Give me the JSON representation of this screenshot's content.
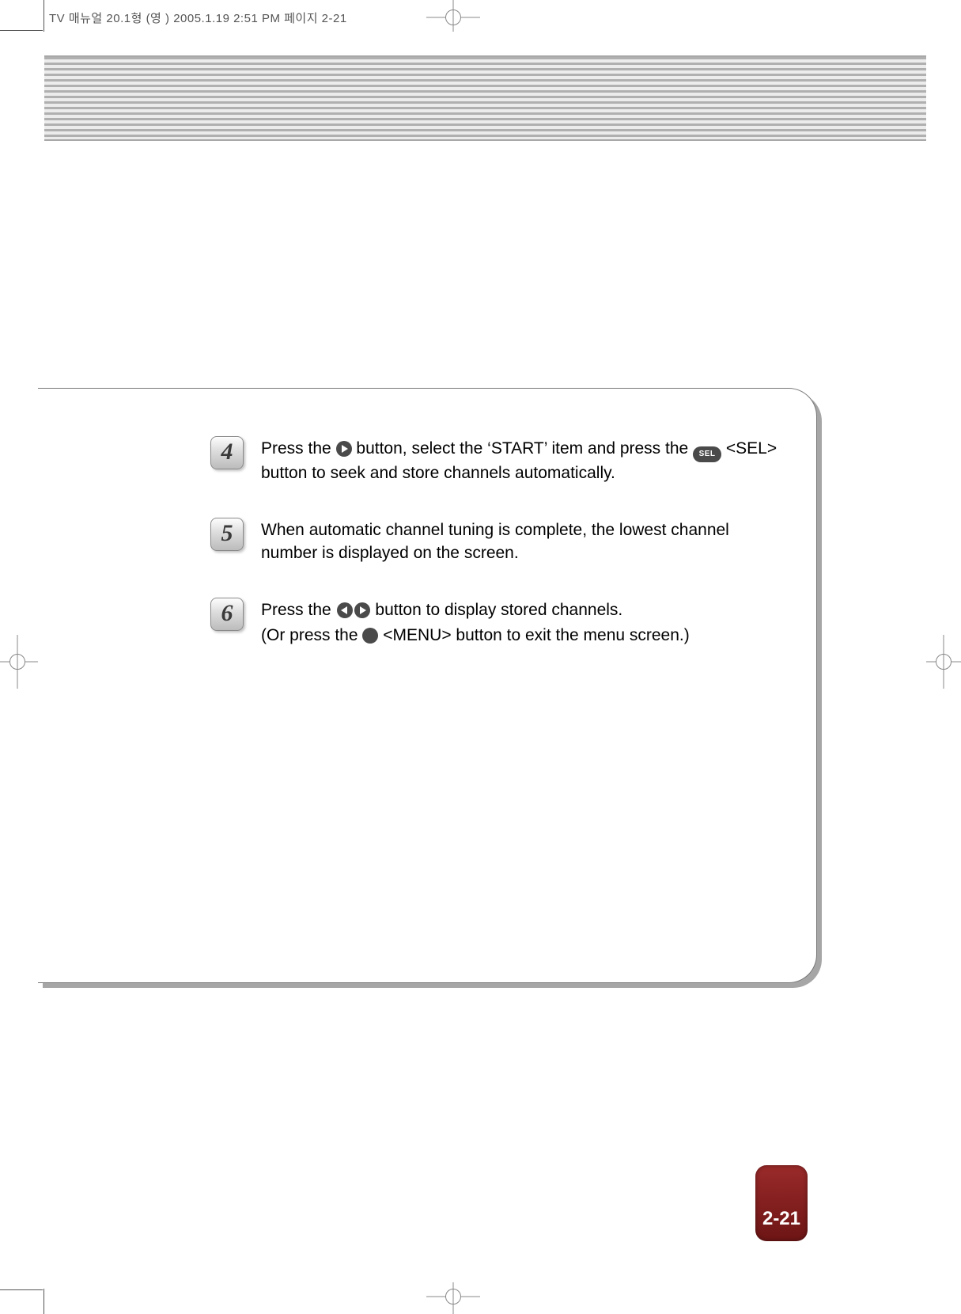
{
  "header": {
    "job_info": "TV 매뉴얼 20.1형 (영 )  2005.1.19 2:51 PM  페이지 2-21"
  },
  "steps": {
    "4": {
      "number": "4",
      "text_a": "Press the ",
      "text_b": " button, select the ‘START’ item and press the ",
      "sel_label": "SEL",
      "text_c": " <SEL> button to seek and store channels automatically."
    },
    "5": {
      "number": "5",
      "text": "When automatic channel tuning is complete, the lowest channel number is displayed on the screen."
    },
    "6": {
      "number": "6",
      "text_a": "Press the ",
      "text_b": " button to display stored channels.",
      "text_c": "(Or press the ",
      "text_d": " <MENU> button to exit the menu screen.)"
    }
  },
  "page_number": "2-21"
}
